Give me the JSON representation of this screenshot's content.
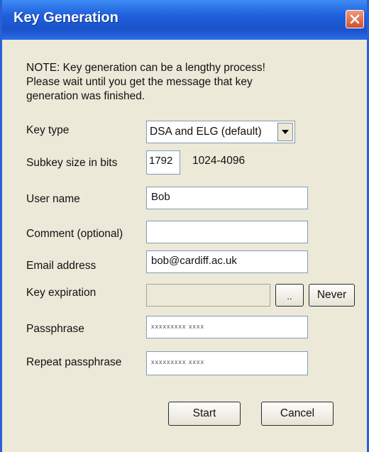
{
  "window": {
    "title": "Key Generation"
  },
  "note": {
    "lines": [
      "NOTE: Key generation can be a lengthy process!",
      "Please wait until you get the message that key",
      "generation was finished."
    ]
  },
  "form": {
    "key_type": {
      "label": "Key type",
      "value": "DSA and ELG (default)"
    },
    "subkey_size": {
      "label": "Subkey size in bits",
      "value": "1792",
      "hint": "1024-4096"
    },
    "user_name": {
      "label": "User name",
      "value": "Bob"
    },
    "comment": {
      "label": "Comment (optional)",
      "value": ""
    },
    "email": {
      "label": "Email address",
      "value": "bob@cardiff.ac.uk"
    },
    "expiration": {
      "label": "Key expiration",
      "value": "",
      "browse_label": "..",
      "never_label": "Never"
    },
    "passphrase": {
      "label": "Passphrase",
      "value": "xxxxxxxxx xxxx"
    },
    "repeat_passphrase": {
      "label": "Repeat passphrase",
      "value": "xxxxxxxxx xxxx"
    }
  },
  "buttons": {
    "start": "Start",
    "cancel": "Cancel"
  },
  "icons": {
    "close": "close-icon",
    "dropdown": "chevron-down-icon"
  },
  "colors": {
    "title_bar": "#1f5fdb",
    "close_button": "#d2502c",
    "dialog_bg": "#ece9d8"
  }
}
